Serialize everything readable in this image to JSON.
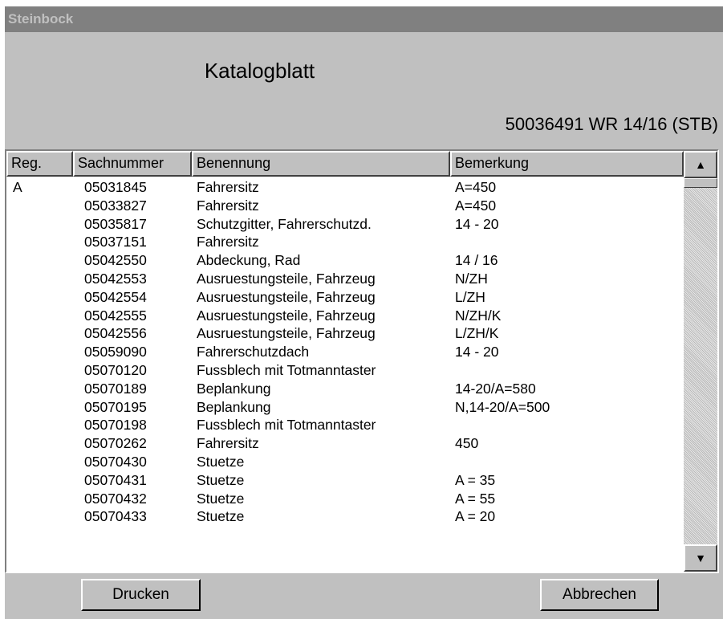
{
  "window": {
    "title": "Steinbock"
  },
  "heading": "Katalogblatt",
  "subheading": "50036491  WR 14/16 (STB)",
  "table": {
    "columns": [
      "Reg.",
      "Sachnummer",
      "Benennung",
      "Bemerkung"
    ],
    "rows": [
      [
        "A",
        "05031845",
        "Fahrersitz",
        "A=450"
      ],
      [
        "",
        "05033827",
        "Fahrersitz",
        "A=450"
      ],
      [
        "",
        "05035817",
        "Schutzgitter, Fahrerschutzd.",
        "14 - 20"
      ],
      [
        "",
        "05037151",
        "Fahrersitz",
        ""
      ],
      [
        "",
        "05042550",
        "Abdeckung, Rad",
        "14 / 16"
      ],
      [
        "",
        "05042553",
        "Ausruestungsteile, Fahrzeug",
        "N/ZH"
      ],
      [
        "",
        "05042554",
        "Ausruestungsteile, Fahrzeug",
        "L/ZH"
      ],
      [
        "",
        "05042555",
        "Ausruestungsteile, Fahrzeug",
        "N/ZH/K"
      ],
      [
        "",
        "05042556",
        "Ausruestungsteile, Fahrzeug",
        "L/ZH/K"
      ],
      [
        "",
        "05059090",
        "Fahrerschutzdach",
        "14 - 20"
      ],
      [
        "",
        "05070120",
        "Fussblech mit Totmanntaster",
        ""
      ],
      [
        "",
        "05070189",
        "Beplankung",
        "14-20/A=580"
      ],
      [
        "",
        "05070195",
        "Beplankung",
        "N,14-20/A=500"
      ],
      [
        "",
        "05070198",
        "Fussblech mit Totmanntaster",
        ""
      ],
      [
        "",
        "05070262",
        "Fahrersitz",
        "450"
      ],
      [
        "",
        "05070430",
        "Stuetze",
        ""
      ],
      [
        "",
        "05070431",
        "Stuetze",
        "A = 35"
      ],
      [
        "",
        "05070432",
        "Stuetze",
        "A = 55"
      ],
      [
        "",
        "05070433",
        "Stuetze",
        "A = 20"
      ]
    ]
  },
  "scrollbar": {
    "up_icon": "▲",
    "down_icon": "▼"
  },
  "buttons": {
    "print": "Drucken",
    "cancel": "Abbrechen"
  },
  "colors": {
    "face": "#c0c0c0",
    "titlebar": "#808080",
    "title_text": "#c0c0c0",
    "list_bg": "#ffffff"
  }
}
